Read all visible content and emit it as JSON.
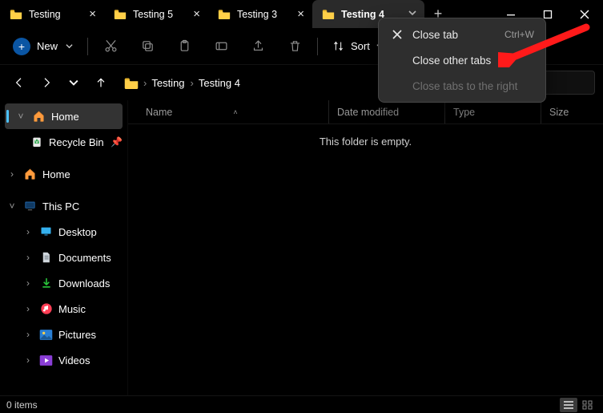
{
  "tabs": [
    {
      "label": "Testing",
      "active": false,
      "showClose": true
    },
    {
      "label": "Testing 5",
      "active": false,
      "showClose": true
    },
    {
      "label": "Testing 3",
      "active": false,
      "showClose": true
    },
    {
      "label": "Testing 4",
      "active": true,
      "showClose": false
    }
  ],
  "toolbar": {
    "new_label": "New",
    "sort_label": "Sort"
  },
  "context_menu": {
    "close_tab": "Close tab",
    "close_tab_shortcut": "Ctrl+W",
    "close_other": "Close other tabs",
    "close_right": "Close tabs to the right"
  },
  "breadcrumbs": [
    "Testing",
    "Testing 4"
  ],
  "search_placeholder": "",
  "sidebar": {
    "items": [
      {
        "kind": "selected",
        "label": "Home",
        "exp": "v",
        "icon": "home"
      },
      {
        "kind": "sub",
        "label": "Recycle Bin",
        "icon": "recycle",
        "pin": true
      },
      {
        "kind": "gap"
      },
      {
        "kind": "top",
        "label": "Home",
        "exp": ">",
        "icon": "home"
      },
      {
        "kind": "gap"
      },
      {
        "kind": "top",
        "label": "This PC",
        "exp": "v",
        "icon": "pc"
      },
      {
        "kind": "subsub",
        "label": "Desktop",
        "exp": ">",
        "icon": "desktop"
      },
      {
        "kind": "subsub",
        "label": "Documents",
        "exp": ">",
        "icon": "documents"
      },
      {
        "kind": "subsub",
        "label": "Downloads",
        "exp": ">",
        "icon": "downloads"
      },
      {
        "kind": "subsub",
        "label": "Music",
        "exp": ">",
        "icon": "music"
      },
      {
        "kind": "subsub",
        "label": "Pictures",
        "exp": ">",
        "icon": "pictures"
      },
      {
        "kind": "subsub",
        "label": "Videos",
        "exp": ">",
        "icon": "videos"
      }
    ]
  },
  "columns": {
    "name": "Name",
    "date": "Date modified",
    "type": "Type",
    "size": "Size"
  },
  "empty_message": "This folder is empty.",
  "status": {
    "items": "0 items"
  }
}
